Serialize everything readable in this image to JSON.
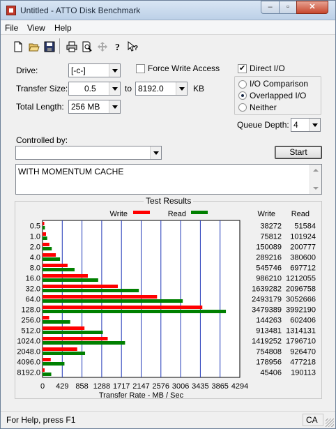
{
  "window": {
    "title": "Untitled - ATTO Disk Benchmark"
  },
  "menu": {
    "file": "File",
    "view": "View",
    "help": "Help"
  },
  "toolbar": {
    "icons": [
      "new-icon",
      "open-icon",
      "save-icon",
      "print-icon",
      "print-preview-icon",
      "move-icon",
      "help-icon",
      "context-help-icon"
    ]
  },
  "drive": {
    "label": "Drive:",
    "value": "[-c-]"
  },
  "force_write": {
    "label": "Force Write Access",
    "checked": false
  },
  "direct_io": {
    "label": "Direct I/O",
    "checked": true
  },
  "transfer_size": {
    "label": "Transfer Size:",
    "from": "0.5",
    "to_label": "to",
    "to": "8192.0",
    "unit": "KB"
  },
  "total_length": {
    "label": "Total Length:",
    "value": "256 MB"
  },
  "io_mode": {
    "options": [
      "I/O Comparison",
      "Overlapped I/O",
      "Neither"
    ],
    "selected": "Overlapped I/O"
  },
  "queue_depth": {
    "label": "Queue Depth:",
    "value": "4"
  },
  "controlled_by": {
    "label": "Controlled by:",
    "value": ""
  },
  "start_button": "Start",
  "description": "WITH MOMENTUM CACHE",
  "results": {
    "title": "Test Results",
    "col_write": "Write",
    "col_read": "Read"
  },
  "chart_data": {
    "type": "bar",
    "orientation": "horizontal",
    "categories": [
      "0.5",
      "1.0",
      "2.0",
      "4.0",
      "8.0",
      "16.0",
      "32.0",
      "64.0",
      "128.0",
      "256.0",
      "512.0",
      "1024.0",
      "2048.0",
      "4096.0",
      "8192.0"
    ],
    "series": [
      {
        "name": "Write",
        "color": "#ff0000",
        "values": [
          38272,
          75812,
          150089,
          289216,
          545746,
          986210,
          1639282,
          2493179,
          3479389,
          144263,
          913481,
          1419252,
          754808,
          178956,
          45406
        ]
      },
      {
        "name": "Read",
        "color": "#008000",
        "values": [
          51584,
          101924,
          200777,
          380600,
          697712,
          1212055,
          2096758,
          3052666,
          3992190,
          602406,
          1314131,
          1796710,
          926470,
          477218,
          190113
        ]
      }
    ],
    "xlabel": "Transfer Rate - MB / Sec",
    "xticks": [
      "0",
      "429",
      "858",
      "1288",
      "1717",
      "2147",
      "2576",
      "3006",
      "3435",
      "3865",
      "4294"
    ],
    "xlim": [
      0,
      4294967
    ],
    "legend": "top"
  },
  "status": {
    "text": "For Help, press F1",
    "indicator": "CA"
  }
}
